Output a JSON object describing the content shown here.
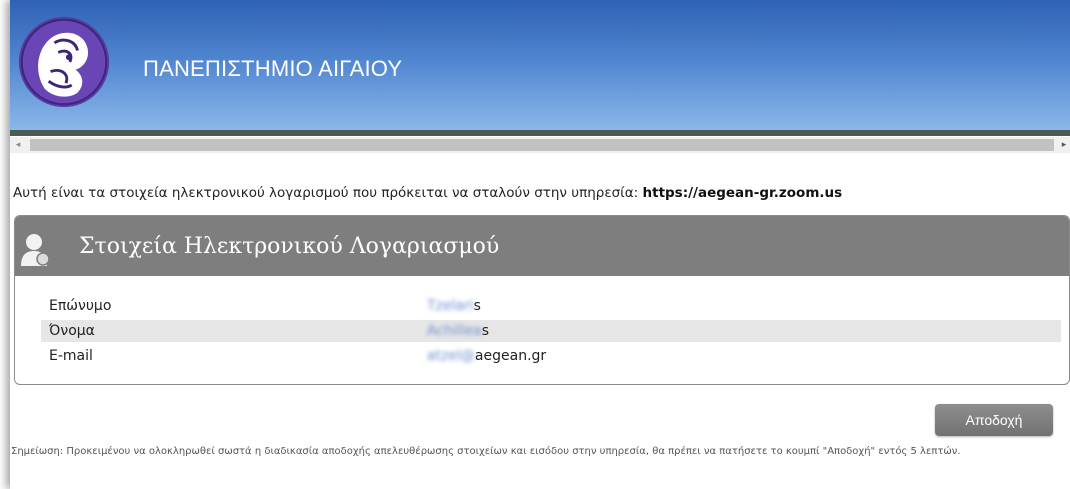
{
  "header": {
    "university_name": "ΠΑΝΕΠΙΣΤΗΜΙΟ ΑΙΓΑΙΟΥ"
  },
  "intro": {
    "text": "Αυτή είναι τα στοιχεία ηλεκτρονικού λογαρισμού που πρόκειται να σταλούν στην υπηρεσία:",
    "service_url": "https://aegean-gr.zoom.us"
  },
  "panel": {
    "title": "Στοιχεία Ηλεκτρονικού Λογαριασμού",
    "rows": [
      {
        "label": "Επώνυμο",
        "value_hidden": "Tzelari",
        "value_visible": "s"
      },
      {
        "label": "Όνομα",
        "value_hidden": "Achillea",
        "value_visible": "s"
      },
      {
        "label": "E-mail",
        "value_hidden": "atzel@",
        "value_visible": "aegean.gr"
      }
    ]
  },
  "actions": {
    "accept_label": "Αποδοχή"
  },
  "note": {
    "text": "Σημείωση: Προκειμένου να ολοκληρωθεί σωστά η διαδικασία αποδοχής απελευθέρωσης στοιχείων και εισόδου στην υπηρεσία, θα πρέπει να πατήσετε το κουμπί \"Αποδοχή\" εντός 5 λεπτών."
  },
  "scrollbar": {
    "left_arrow": "◂",
    "right_arrow": "▸"
  },
  "colors": {
    "header_top": "#2f62b4",
    "header_bottom": "#8ab8ea",
    "panel_header": "#7e7e7e",
    "accept_button": "#7f7f7f"
  },
  "icons": [
    "university-logo",
    "user-icon"
  ]
}
